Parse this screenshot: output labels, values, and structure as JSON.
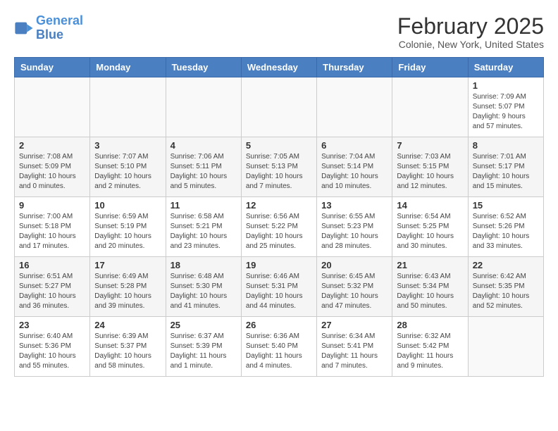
{
  "header": {
    "logo_line1": "General",
    "logo_line2": "Blue",
    "title": "February 2025",
    "subtitle": "Colonie, New York, United States"
  },
  "weekdays": [
    "Sunday",
    "Monday",
    "Tuesday",
    "Wednesday",
    "Thursday",
    "Friday",
    "Saturday"
  ],
  "weeks": [
    [
      {
        "day": "",
        "info": ""
      },
      {
        "day": "",
        "info": ""
      },
      {
        "day": "",
        "info": ""
      },
      {
        "day": "",
        "info": ""
      },
      {
        "day": "",
        "info": ""
      },
      {
        "day": "",
        "info": ""
      },
      {
        "day": "1",
        "info": "Sunrise: 7:09 AM\nSunset: 5:07 PM\nDaylight: 9 hours and 57 minutes."
      }
    ],
    [
      {
        "day": "2",
        "info": "Sunrise: 7:08 AM\nSunset: 5:09 PM\nDaylight: 10 hours and 0 minutes."
      },
      {
        "day": "3",
        "info": "Sunrise: 7:07 AM\nSunset: 5:10 PM\nDaylight: 10 hours and 2 minutes."
      },
      {
        "day": "4",
        "info": "Sunrise: 7:06 AM\nSunset: 5:11 PM\nDaylight: 10 hours and 5 minutes."
      },
      {
        "day": "5",
        "info": "Sunrise: 7:05 AM\nSunset: 5:13 PM\nDaylight: 10 hours and 7 minutes."
      },
      {
        "day": "6",
        "info": "Sunrise: 7:04 AM\nSunset: 5:14 PM\nDaylight: 10 hours and 10 minutes."
      },
      {
        "day": "7",
        "info": "Sunrise: 7:03 AM\nSunset: 5:15 PM\nDaylight: 10 hours and 12 minutes."
      },
      {
        "day": "8",
        "info": "Sunrise: 7:01 AM\nSunset: 5:17 PM\nDaylight: 10 hours and 15 minutes."
      }
    ],
    [
      {
        "day": "9",
        "info": "Sunrise: 7:00 AM\nSunset: 5:18 PM\nDaylight: 10 hours and 17 minutes."
      },
      {
        "day": "10",
        "info": "Sunrise: 6:59 AM\nSunset: 5:19 PM\nDaylight: 10 hours and 20 minutes."
      },
      {
        "day": "11",
        "info": "Sunrise: 6:58 AM\nSunset: 5:21 PM\nDaylight: 10 hours and 23 minutes."
      },
      {
        "day": "12",
        "info": "Sunrise: 6:56 AM\nSunset: 5:22 PM\nDaylight: 10 hours and 25 minutes."
      },
      {
        "day": "13",
        "info": "Sunrise: 6:55 AM\nSunset: 5:23 PM\nDaylight: 10 hours and 28 minutes."
      },
      {
        "day": "14",
        "info": "Sunrise: 6:54 AM\nSunset: 5:25 PM\nDaylight: 10 hours and 30 minutes."
      },
      {
        "day": "15",
        "info": "Sunrise: 6:52 AM\nSunset: 5:26 PM\nDaylight: 10 hours and 33 minutes."
      }
    ],
    [
      {
        "day": "16",
        "info": "Sunrise: 6:51 AM\nSunset: 5:27 PM\nDaylight: 10 hours and 36 minutes."
      },
      {
        "day": "17",
        "info": "Sunrise: 6:49 AM\nSunset: 5:28 PM\nDaylight: 10 hours and 39 minutes."
      },
      {
        "day": "18",
        "info": "Sunrise: 6:48 AM\nSunset: 5:30 PM\nDaylight: 10 hours and 41 minutes."
      },
      {
        "day": "19",
        "info": "Sunrise: 6:46 AM\nSunset: 5:31 PM\nDaylight: 10 hours and 44 minutes."
      },
      {
        "day": "20",
        "info": "Sunrise: 6:45 AM\nSunset: 5:32 PM\nDaylight: 10 hours and 47 minutes."
      },
      {
        "day": "21",
        "info": "Sunrise: 6:43 AM\nSunset: 5:34 PM\nDaylight: 10 hours and 50 minutes."
      },
      {
        "day": "22",
        "info": "Sunrise: 6:42 AM\nSunset: 5:35 PM\nDaylight: 10 hours and 52 minutes."
      }
    ],
    [
      {
        "day": "23",
        "info": "Sunrise: 6:40 AM\nSunset: 5:36 PM\nDaylight: 10 hours and 55 minutes."
      },
      {
        "day": "24",
        "info": "Sunrise: 6:39 AM\nSunset: 5:37 PM\nDaylight: 10 hours and 58 minutes."
      },
      {
        "day": "25",
        "info": "Sunrise: 6:37 AM\nSunset: 5:39 PM\nDaylight: 11 hours and 1 minute."
      },
      {
        "day": "26",
        "info": "Sunrise: 6:36 AM\nSunset: 5:40 PM\nDaylight: 11 hours and 4 minutes."
      },
      {
        "day": "27",
        "info": "Sunrise: 6:34 AM\nSunset: 5:41 PM\nDaylight: 11 hours and 7 minutes."
      },
      {
        "day": "28",
        "info": "Sunrise: 6:32 AM\nSunset: 5:42 PM\nDaylight: 11 hours and 9 minutes."
      },
      {
        "day": "",
        "info": ""
      }
    ]
  ]
}
